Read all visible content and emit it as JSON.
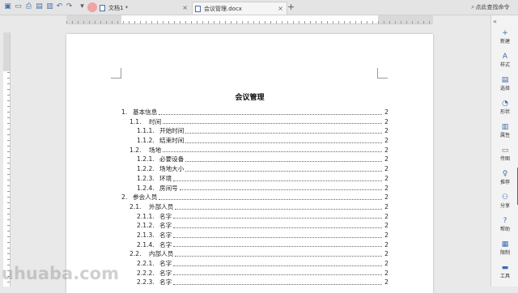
{
  "toolbar": {
    "quick_icons": [
      "save-icon",
      "open-folder-icon",
      "print-icon",
      "print-preview-icon",
      "export-icon",
      "undo-icon",
      "redo-icon",
      "dropdown-arrow-icon"
    ]
  },
  "tabs": [
    {
      "label": "文档1 *",
      "close": "×"
    },
    {
      "label": "会议管理.docx",
      "close": "×"
    }
  ],
  "new_tab_symbol": "+",
  "search": {
    "icon": "⌕",
    "label": "点此查找命令"
  },
  "document": {
    "title": "会议管理",
    "toc": [
      {
        "level": 1,
        "num": "1.",
        "text": "基本信息",
        "page": "2"
      },
      {
        "level": 2,
        "num": "1.1.",
        "text": "时间",
        "page": "2"
      },
      {
        "level": 3,
        "num": "1.1.1.",
        "text": "开始时间",
        "page": "2"
      },
      {
        "level": 3,
        "num": "1.1.2.",
        "text": "结束时间",
        "page": "2"
      },
      {
        "level": 2,
        "num": "1.2.",
        "text": "场地",
        "page": "2"
      },
      {
        "level": 3,
        "num": "1.2.1.",
        "text": "必要设备",
        "page": "2"
      },
      {
        "level": 3,
        "num": "1.2.2.",
        "text": "场地大小",
        "page": "2"
      },
      {
        "level": 3,
        "num": "1.2.3.",
        "text": "环境",
        "page": "2"
      },
      {
        "level": 3,
        "num": "1.2.4.",
        "text": "房间号",
        "page": "2"
      },
      {
        "level": 1,
        "num": "2.",
        "text": "参会人员",
        "page": "2"
      },
      {
        "level": 2,
        "num": "2.1.",
        "text": "外部人员",
        "page": "2"
      },
      {
        "level": 3,
        "num": "2.1.1.",
        "text": "名字",
        "page": "2"
      },
      {
        "level": 3,
        "num": "2.1.2.",
        "text": "名字",
        "page": "2"
      },
      {
        "level": 3,
        "num": "2.1.3.",
        "text": "名字",
        "page": "2"
      },
      {
        "level": 3,
        "num": "2.1.4.",
        "text": "名字",
        "page": "2"
      },
      {
        "level": 2,
        "num": "2.2.",
        "text": "内部人员",
        "page": "2"
      },
      {
        "level": 3,
        "num": "2.2.1.",
        "text": "名字",
        "page": "2"
      },
      {
        "level": 3,
        "num": "2.2.2.",
        "text": "名字",
        "page": "2"
      },
      {
        "level": 3,
        "num": "2.2.3.",
        "text": "名字",
        "page": "2"
      }
    ]
  },
  "sidepanel": {
    "collapse": "«",
    "items": [
      {
        "label": "新建",
        "icon": "new-icon",
        "glyph": "+"
      },
      {
        "label": "样式",
        "icon": "style-icon",
        "glyph": "A"
      },
      {
        "label": "选择",
        "icon": "select-icon",
        "glyph": "▤"
      },
      {
        "label": "形状",
        "icon": "shape-icon",
        "glyph": "◔"
      },
      {
        "label": "属性",
        "icon": "properties-icon",
        "glyph": "▥"
      },
      {
        "label": "传图",
        "icon": "upload-image-icon",
        "glyph": "▭"
      },
      {
        "label": "推荐",
        "icon": "recommend-icon",
        "glyph": "♀"
      },
      {
        "label": "分享",
        "icon": "share-icon",
        "glyph": "⚇"
      },
      {
        "label": "帮助",
        "icon": "help-icon",
        "glyph": "?"
      },
      {
        "label": "限制",
        "icon": "restrict-icon",
        "glyph": "▦"
      },
      {
        "label": "工具",
        "icon": "tools-icon",
        "glyph": "▬"
      }
    ]
  },
  "watermark": "uhuaba.com",
  "colors": {
    "accent": "#3d6ab0",
    "avatar": "#f0a3a3"
  }
}
